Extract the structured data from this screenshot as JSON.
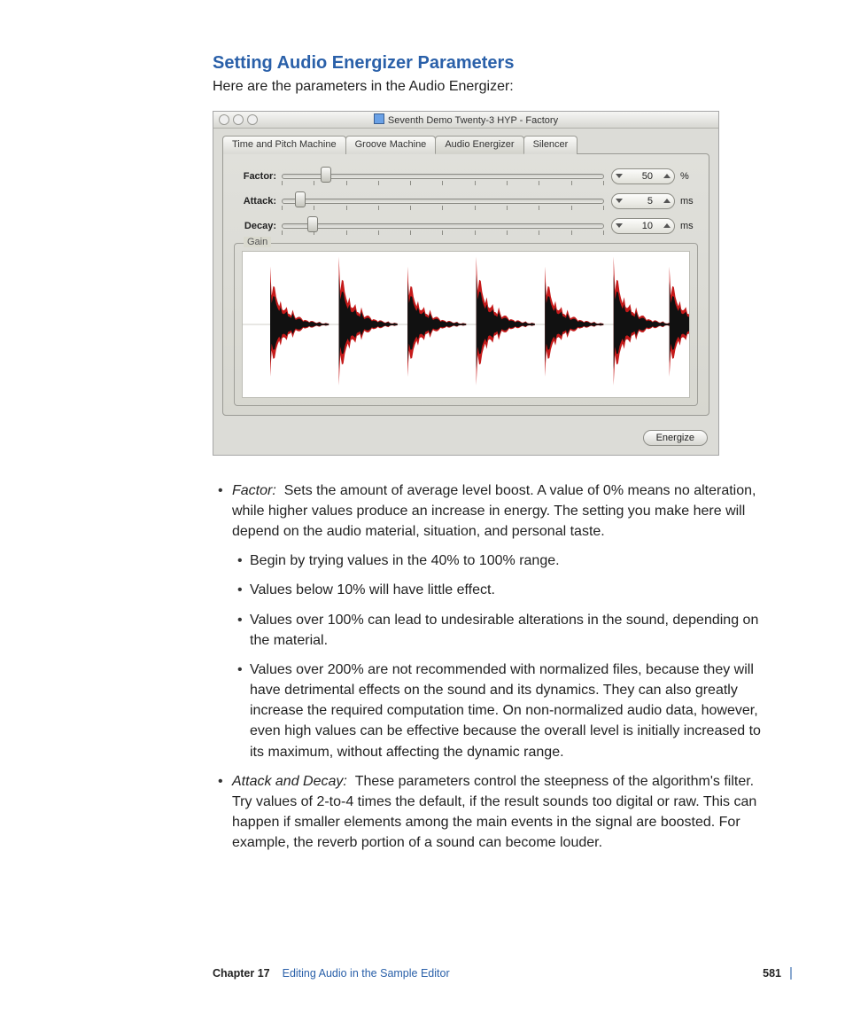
{
  "section_title": "Setting Audio Energizer Parameters",
  "intro": "Here are the parameters in the Audio Energizer:",
  "window": {
    "title": "Seventh Demo Twenty-3 HYP - Factory",
    "tabs": [
      "Time and Pitch Machine",
      "Groove Machine",
      "Audio Energizer",
      "Silencer"
    ],
    "active_tab_index": 2,
    "params": {
      "factor": {
        "label": "Factor:",
        "value": "50",
        "unit": "%",
        "thumb_pct": 12
      },
      "attack": {
        "label": "Attack:",
        "value": "5",
        "unit": "ms",
        "thumb_pct": 4
      },
      "decay": {
        "label": "Decay:",
        "value": "10",
        "unit": "ms",
        "thumb_pct": 8
      }
    },
    "gain_label": "Gain",
    "energize_label": "Energize"
  },
  "bullets": {
    "factor": {
      "term": "Factor:",
      "body": "Sets the amount of average level boost. A value of 0% means no alteration, while higher values produce an increase in energy. The setting you make here will depend on the audio material, situation, and personal taste.",
      "sub": [
        "Begin by trying values in the 40% to 100% range.",
        "Values below 10% will have little effect.",
        "Values over 100% can lead to undesirable alterations in the sound, depending on the material.",
        "Values over 200% are not recommended with normalized files, because they will have detrimental effects on the sound and its dynamics. They can also greatly increase the required computation time. On non-normalized audio data, however, even high values can be effective because the overall level is initially increased to its maximum, without affecting the dynamic range."
      ]
    },
    "attack_decay": {
      "term": "Attack and Decay:",
      "body": "These parameters control the steepness of the algorithm's filter. Try values of 2-to-4 times the default, if the result sounds too digital or raw. This can happen if smaller elements among the main events in the signal are boosted. For example, the reverb portion of a sound can become louder."
    }
  },
  "footer": {
    "chapter_label": "Chapter 17",
    "chapter_name": "Editing Audio in the Sample Editor",
    "page_number": "581"
  }
}
